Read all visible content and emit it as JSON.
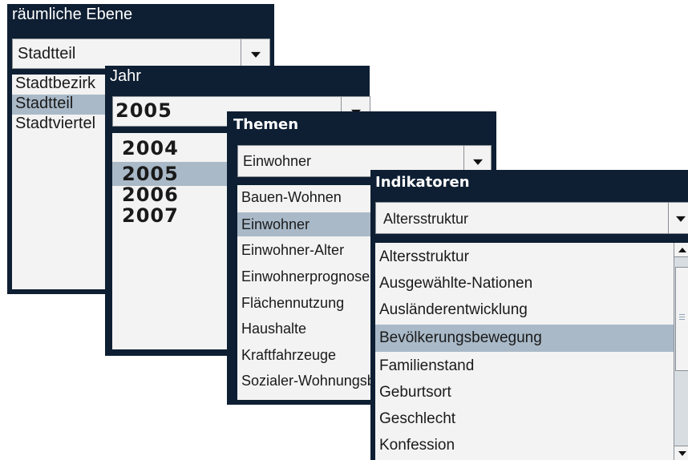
{
  "panels": {
    "raeumliche": {
      "title": "räumliche Ebene",
      "selected": "Stadtteil",
      "options": [
        "Stadtbezirk",
        "Stadtteil",
        "Stadtviertel"
      ],
      "highlighted_index": 1
    },
    "jahr": {
      "title": "Jahr",
      "selected": "2005",
      "options": [
        "2004",
        "2005",
        "2006",
        "2007"
      ],
      "highlighted_index": 1
    },
    "themen": {
      "title": "Themen",
      "selected": "Einwohner",
      "options": [
        "Bauen-Wohnen",
        "Einwohner",
        "Einwohner-Alter",
        "Einwohnerprognose",
        "Flächennutzung",
        "Haushalte",
        "Kraftfahrzeuge",
        "Sozialer-Wohnungsbau"
      ],
      "highlighted_index": 1
    },
    "indikatoren": {
      "title": "Indikatoren",
      "selected": "Altersstruktur",
      "options": [
        "Altersstruktur",
        "Ausgewählte-Nationen",
        "Ausländerentwicklung",
        "Bevölkerungsbewegung",
        "Familienstand",
        "Geburtsort",
        "Geschlecht",
        "Konfession"
      ],
      "highlighted_index": 3
    }
  },
  "icons": {
    "dropdown": "chevron-down-icon",
    "scroll_up": "scroll-up-icon",
    "scroll_down": "scroll-down-icon"
  },
  "colors": {
    "panel_bg": "#0e1f33",
    "list_bg": "#f3f3f3",
    "selection": "#a9b9c8"
  }
}
